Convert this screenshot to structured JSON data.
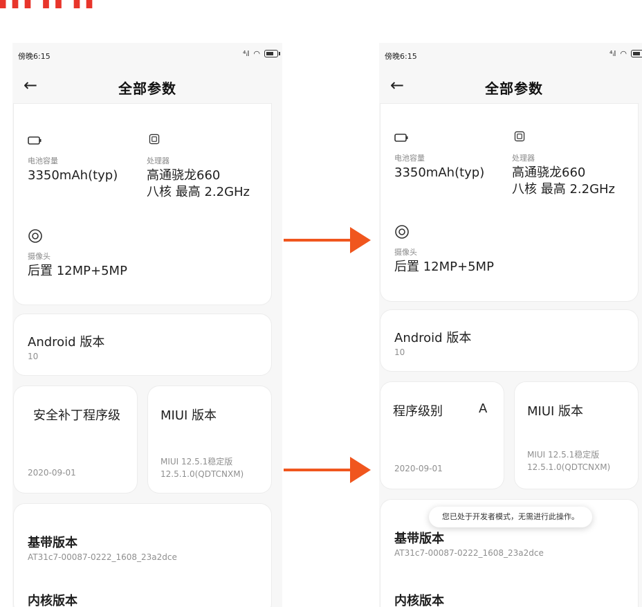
{
  "screens": [
    {
      "status_time": "傍晚6:15",
      "title": "全部参数",
      "battery": {
        "label": "电池容量",
        "value": "3350mAh(typ)"
      },
      "cpu": {
        "label": "处理器",
        "value_line1": "高通骁龙660",
        "value_line2": "八核 最高 2.2GHz"
      },
      "camera": {
        "label": "摄像头",
        "value": "后置 12MP+5MP"
      },
      "android": {
        "title": "Android 版本",
        "value": "10"
      },
      "security": {
        "title": "安全补丁程序级",
        "value": "2020-09-01"
      },
      "miui": {
        "title": "MIUI 版本",
        "value_line1": "MIUI 12.5.1稳定版",
        "value_line2": "12.5.1.0(QDTCNXM)"
      },
      "baseband": {
        "title": "基带版本",
        "value": "AT31c7-00087-0222_1608_23a2dce"
      },
      "kernel": {
        "title": "内核版本"
      }
    },
    {
      "status_time": "傍晚6:15",
      "title": "全部参数",
      "battery": {
        "label": "电池容量",
        "value": "3350mAh(typ)"
      },
      "cpu": {
        "label": "处理器",
        "value_line1": "高通骁龙660",
        "value_line2": "八核 最高 2.2GHz"
      },
      "camera": {
        "label": "摄像头",
        "value": "后置 12MP+5MP"
      },
      "android": {
        "title": "Android 版本",
        "value": "10"
      },
      "security": {
        "title": "程序级别",
        "title_tail": "A",
        "value": "2020-09-01"
      },
      "miui": {
        "title": "MIUI 版本",
        "value_line1": "MIUI 12.5.1稳定版",
        "value_line2": "12.5.1.0(QDTCNXM)"
      },
      "baseband": {
        "title": "基带版本",
        "value": "AT31c7-00087-0222_1608_23a2dce"
      },
      "kernel": {
        "title": "内核版本"
      },
      "toast": "您已处于开发者模式，无需进行此操作。"
    }
  ],
  "colors": {
    "arrow": "#f0561e",
    "top_text": "#e8352b"
  }
}
